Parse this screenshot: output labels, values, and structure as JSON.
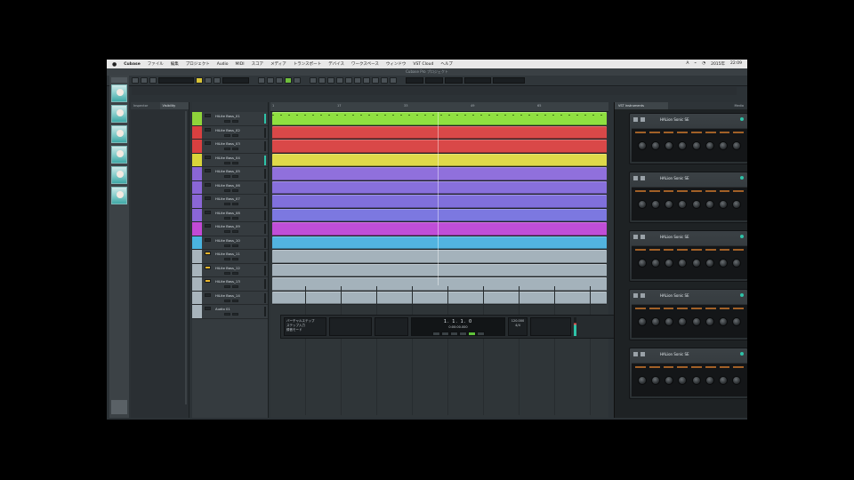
{
  "menubar": {
    "apple": "",
    "app_name": "Cubase",
    "items": [
      "ファイル",
      "編集",
      "プロジェクト",
      "Audio",
      "MIDI",
      "スコア",
      "メディア",
      "トランスポート",
      "デバイス",
      "ワークスペース",
      "ウィンドウ",
      "VST Cloud",
      "ヘルプ"
    ],
    "status": [
      "A",
      "⌁",
      "◔",
      "2015年",
      "22:09"
    ]
  },
  "titlebar": {
    "text": "Cubase Pro プロジェクト"
  },
  "toolbar": {
    "field_1": "",
    "field_2": "",
    "field_3": ""
  },
  "inspector": {
    "tab_1": "Inspector",
    "tab_2": "Visibility"
  },
  "tracks": [
    {
      "name": "HiLite Bass_01",
      "color": "#8fd43a"
    },
    {
      "name": "HiLite Bass_02",
      "color": "#d94040"
    },
    {
      "name": "HiLite Bass_03",
      "color": "#d94040"
    },
    {
      "name": "HiLite Bass_04",
      "color": "#d9d43a"
    },
    {
      "name": "HiLite Bass_05",
      "color": "#8a66d6"
    },
    {
      "name": "HiLite Bass_06",
      "color": "#8a66d6"
    },
    {
      "name": "HiLite Bass_07",
      "color": "#8a66d6"
    },
    {
      "name": "HiLite Bass_08",
      "color": "#8a66d6"
    },
    {
      "name": "HiLite Bass_09",
      "color": "#c24ad6"
    },
    {
      "name": "HiLite Bass_10",
      "color": "#4ab4e0"
    },
    {
      "name": "HiLite Bass_11",
      "color": "#a8b4bc"
    },
    {
      "name": "HiLite Bass_12",
      "color": "#a8b4bc"
    },
    {
      "name": "HiLite Bass_13",
      "color": "#a8b4bc"
    },
    {
      "name": "HiLite Bass_14",
      "color": "#a8b4bc"
    },
    {
      "name": "Audio 01",
      "color": "#a8b4bc"
    }
  ],
  "lanes": [
    {
      "color": "#8fe040",
      "event": true
    },
    {
      "color": "#d94848",
      "event": true
    },
    {
      "color": "#d94848",
      "event": true
    },
    {
      "color": "#dfd94a",
      "event": true
    },
    {
      "color": "#9070dc",
      "event": true
    },
    {
      "color": "#8870dc",
      "event": true
    },
    {
      "color": "#8070dc",
      "event": true
    },
    {
      "color": "#7c78e0",
      "event": true
    },
    {
      "color": "#c04ed8",
      "event": true
    },
    {
      "color": "#52b4e0",
      "event": true
    },
    {
      "color": "#a4b2bb",
      "event": true
    },
    {
      "color": "#a4b2bb",
      "event": true
    },
    {
      "color": "#a4b2bb",
      "event": true
    },
    {
      "color": "#a4b2bb",
      "event": true
    }
  ],
  "ruler": {
    "ticks": [
      "1",
      "17",
      "33",
      "49",
      "65"
    ]
  },
  "transport": {
    "info_lines": [
      "バーチャルステップ",
      "ステップ入力",
      "録音モード"
    ],
    "box_2": [
      "",
      "",
      ""
    ],
    "box_3": [
      "",
      ""
    ],
    "time": "1. 1. 1. 0",
    "time_sub": "0:00:00.000",
    "tempo": "120.000",
    "signature": "4/4"
  },
  "rack": {
    "tab_active": "VST Instruments",
    "tab_right": "Media",
    "instruments": [
      {
        "name": "HALion Sonic SE"
      },
      {
        "name": "HALion Sonic SE"
      },
      {
        "name": "HALion Sonic SE"
      },
      {
        "name": "HALion Sonic SE"
      },
      {
        "name": "HALion Sonic SE"
      }
    ]
  },
  "colors": {
    "accent_green": "#5fc23a",
    "meter": "#2ec3a8"
  }
}
